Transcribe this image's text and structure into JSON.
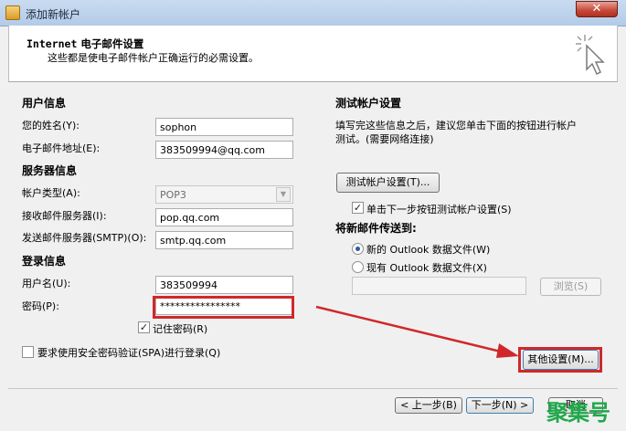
{
  "window": {
    "title": "添加新帐户",
    "close_glyph": "✕"
  },
  "header": {
    "title_prefix": "Internet",
    "title_rest": " 电子邮件设置",
    "subtitle": "这些都是使电子邮件帐户正确运行的必需设置。"
  },
  "user_info": {
    "title": "用户信息",
    "name_label": "您的姓名(Y):",
    "name_value": "sophon",
    "email_label": "电子邮件地址(E):",
    "email_value": "383509994@qq.com"
  },
  "server_info": {
    "title": "服务器信息",
    "type_label": "帐户类型(A):",
    "type_value": "POP3",
    "incoming_label": "接收邮件服务器(I):",
    "incoming_value": "pop.qq.com",
    "outgoing_label": "发送邮件服务器(SMTP)(O):",
    "outgoing_value": "smtp.qq.com"
  },
  "login_info": {
    "title": "登录信息",
    "username_label": "用户名(U):",
    "username_value": "383509994",
    "password_label": "密码(P):",
    "password_value": "****************",
    "remember_label": "记住密码(R)",
    "remember_checked": true,
    "spa_label": "要求使用安全密码验证(SPA)进行登录(Q)",
    "spa_checked": false
  },
  "test_settings": {
    "title": "测试帐户设置",
    "desc_line1": "填写完这些信息之后，建议您单击下面的按钮进行帐户",
    "desc_line2": "测试。(需要网络连接)",
    "test_button": "测试帐户设置(T)...",
    "auto_test_label": "单击下一步按钮测试帐户设置(S)",
    "auto_test_checked": true
  },
  "deliver_to": {
    "title": "将新邮件传送到:",
    "option_new": "新的 Outlook 数据文件(W)",
    "option_existing": "现有 Outlook 数据文件(X)",
    "selected": "new",
    "path_value": "",
    "browse_button": "浏览(S)"
  },
  "more_settings_button": "其他设置(M)...",
  "footer": {
    "back_button": "< 上一步(B)",
    "next_button": "下一步(N) >",
    "cancel_button": "取消"
  },
  "watermark": "聚集号",
  "colors": {
    "highlight": "#d0282a",
    "accent_blue": "#2a5aa8",
    "watermark": "#1fa84a"
  }
}
